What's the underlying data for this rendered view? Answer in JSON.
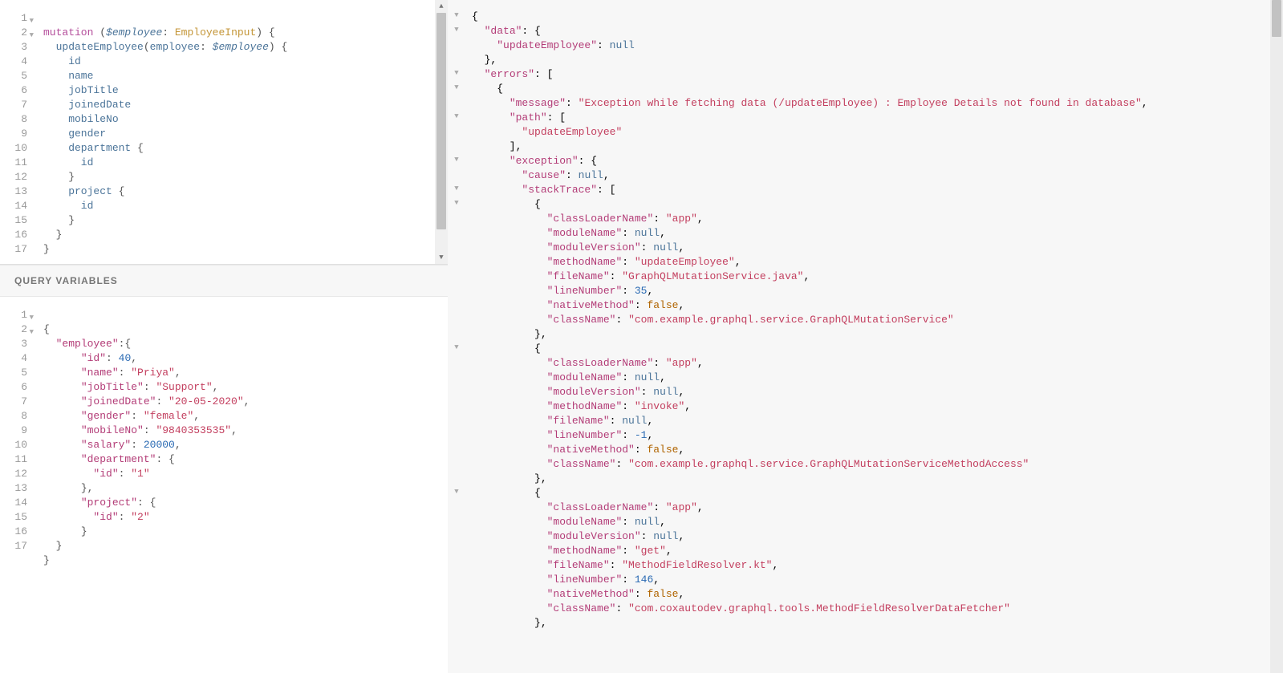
{
  "sectionHeader": "QUERY VARIABLES",
  "query": {
    "lineCount": 17,
    "foldLines": [
      1,
      2
    ],
    "tokens": {
      "l1_mutation": "mutation",
      "l1_lp": " (",
      "l1_var": "$employee",
      "l1_colon": ": ",
      "l1_type": "EmployeeInput",
      "l1_rp": ") {",
      "l2_field": "  updateEmployee",
      "l2_lp": "(",
      "l2_arg": "employee",
      "l2_colon": ": ",
      "l2_var": "$employee",
      "l2_rp": ") {",
      "l3": "    id",
      "l4": "    name",
      "l5": "    jobTitle",
      "l6": "    joinedDate",
      "l7": "    mobileNo",
      "l8": "    gender",
      "l9_field": "    department",
      "l9_brace": " {",
      "l10": "      id",
      "l11": "    }",
      "l12_field": "    project",
      "l12_brace": " {",
      "l13": "      id",
      "l14": "    }",
      "l15": "  }",
      "l16": "}"
    }
  },
  "vars": {
    "lineCount": 17,
    "foldLines": [
      1,
      2
    ],
    "data": {
      "open": "{",
      "k_employee": "\"employee\"",
      "v_open": ":{",
      "k_id": "\"id\"",
      "v_id": "40",
      "k_name": "\"name\"",
      "v_name": "\"Priya\"",
      "k_jobTitle": "\"jobTitle\"",
      "v_jobTitle": "\"Support\"",
      "k_joinedDate": "\"joinedDate\"",
      "v_joinedDate": "\"20-05-2020\"",
      "k_gender": "\"gender\"",
      "v_gender": "\"female\"",
      "k_mobileNo": "\"mobileNo\"",
      "v_mobileNo": "\"9840353535\"",
      "k_salary": "\"salary\"",
      "v_salary": "20000",
      "k_department": "\"department\"",
      "v_dep_open": ": {",
      "k_dep_id": "\"id\"",
      "v_dep_id": "\"1\"",
      "v_dep_close": "},",
      "k_project": "\"project\"",
      "v_proj_open": ": {",
      "k_proj_id": "\"id\"",
      "v_proj_id": "\"2\"",
      "v_proj_close": "}",
      "close_emp": "}",
      "close": "}"
    }
  },
  "response": {
    "open": "{",
    "k_data": "\"data\"",
    "k_updateEmployee": "\"updateEmployee\"",
    "v_null": "null",
    "k_errors": "\"errors\"",
    "k_message": "\"message\"",
    "v_message": "\"Exception while fetching data (/updateEmployee) : Employee Details not found in database\"",
    "k_path": "\"path\"",
    "v_path0": "\"updateEmployee\"",
    "k_exception": "\"exception\"",
    "k_cause": "\"cause\"",
    "k_stackTrace": "\"stackTrace\"",
    "st": [
      {
        "classLoaderName": "\"app\"",
        "moduleName": "null",
        "moduleVersion": "null",
        "methodName": "\"updateEmployee\"",
        "fileName": "\"GraphQLMutationService.java\"",
        "lineNumber": "35",
        "nativeMethod": "false",
        "className": "\"com.example.graphql.service.GraphQLMutationService\""
      },
      {
        "classLoaderName": "\"app\"",
        "moduleName": "null",
        "moduleVersion": "null",
        "methodName": "\"invoke\"",
        "fileName": "null",
        "lineNumber": "-1",
        "nativeMethod": "false",
        "className": "\"com.example.graphql.service.GraphQLMutationServiceMethodAccess\""
      },
      {
        "classLoaderName": "\"app\"",
        "moduleName": "null",
        "moduleVersion": "null",
        "methodName": "\"get\"",
        "fileName": "\"MethodFieldResolver.kt\"",
        "lineNumber": "146",
        "nativeMethod": "false",
        "className": "\"com.coxautodev.graphql.tools.MethodFieldResolverDataFetcher\""
      }
    ],
    "keys": {
      "classLoaderName": "\"classLoaderName\"",
      "moduleName": "\"moduleName\"",
      "moduleVersion": "\"moduleVersion\"",
      "methodName": "\"methodName\"",
      "fileName": "\"fileName\"",
      "lineNumber": "\"lineNumber\"",
      "nativeMethod": "\"nativeMethod\"",
      "className": "\"className\""
    }
  }
}
